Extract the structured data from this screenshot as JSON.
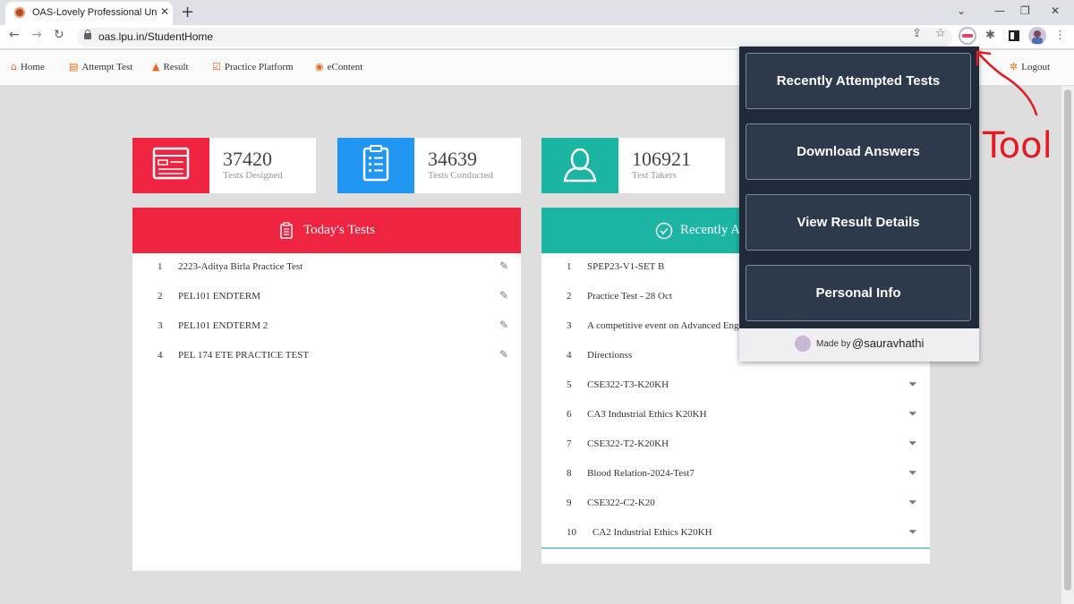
{
  "browser": {
    "tab_title": "OAS-Lovely Professional Universit",
    "tab_close": "✕",
    "new_tab": "+",
    "url": "oas.lpu.in/StudentHome",
    "controls": {
      "minimize": "⌄",
      "restore": "—",
      "maximize": "❐",
      "close": "✕"
    }
  },
  "nav": {
    "home": "Home",
    "attempt_test": "Attempt Test",
    "result": "Result",
    "practice_platform": "Practice Platform",
    "econtent": "eContent",
    "logout": "Logout"
  },
  "stats": [
    {
      "value": "37420",
      "label": "Tests Designed",
      "color": "#ee2440"
    },
    {
      "value": "34639",
      "label": "Tests Conducted",
      "color": "#2196f3"
    },
    {
      "value": "106921",
      "label": "Test Takers",
      "color": "#1cb5a4"
    }
  ],
  "todays_tests": {
    "title": "Today's Tests",
    "color": "#ee2440",
    "rows": [
      {
        "n": "1",
        "name": "2223-Aditya Birla Practice Test"
      },
      {
        "n": "2",
        "name": "PEL101 ENDTERM"
      },
      {
        "n": "3",
        "name": "PEL101 ENDTERM 2"
      },
      {
        "n": "4",
        "name": "PEL 174 ETE PRACTICE TEST"
      }
    ]
  },
  "recent_tests": {
    "title": "Recently A",
    "color": "#1cb5a4",
    "rows": [
      {
        "n": "1",
        "name": "SPEP23-V1-SET B"
      },
      {
        "n": "2",
        "name": "Practice Test - 28 Oct"
      },
      {
        "n": "3",
        "name": "A competitive event on Advanced Eng"
      },
      {
        "n": "4",
        "name": "Directionss"
      },
      {
        "n": "5",
        "name": "CSE322-T3-K20KH"
      },
      {
        "n": "6",
        "name": "CA3 Industrial Ethics K20KH"
      },
      {
        "n": "7",
        "name": "CSE322-T2-K20KH"
      },
      {
        "n": "8",
        "name": "Blood Relation-2024-Test7"
      },
      {
        "n": "9",
        "name": "CSE322-C2-K20"
      },
      {
        "n": "10",
        "name": "CA2 Industrial Ethics K20KH"
      }
    ]
  },
  "popup": {
    "buttons": [
      "Recently Attempted Tests",
      "Download Answers",
      "View Result Details",
      "Personal Info"
    ],
    "made_by": "Made by",
    "handle": "@sauravhathi"
  },
  "annotation": {
    "text": "Tool",
    "color": "#e31b23"
  }
}
